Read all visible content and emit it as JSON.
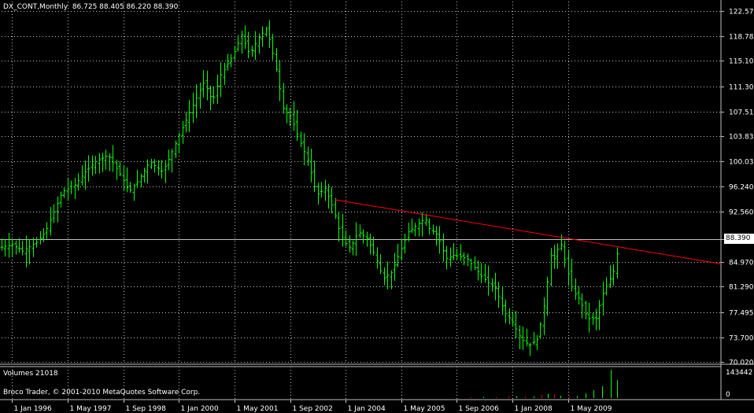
{
  "header": {
    "symbol_text": "DX_CONT,Monthly",
    "ohlc_text": "86.725 88.405 86.220 88.390"
  },
  "volume_header": {
    "label": "Volumes 21018"
  },
  "copyright": "Broco Trader, © 2001-2010 MetaQuotes Software Corp.",
  "current_price_label": "88.390",
  "colors": {
    "background": "#000000",
    "candle": "#00ff00",
    "trendline": "#ff0000",
    "grid": "#c0c0c0",
    "axis_text": "#ffffff",
    "volume_green": "#00ff00",
    "volume_red": "#ff0000",
    "price_line": "#c0c0c0"
  },
  "chart_data": {
    "type": "candlestick",
    "symbol": "DX_CONT",
    "timeframe": "Monthly",
    "y_ticks": [
      "122.575",
      "118.780",
      "115.100",
      "111.305",
      "107.510",
      "103.830",
      "100.035",
      "96.240",
      "92.560",
      "88.390",
      "84.970",
      "81.290",
      "77.495",
      "73.700",
      "70.020"
    ],
    "y_tick_values": [
      122.575,
      118.78,
      115.1,
      111.305,
      107.51,
      103.83,
      100.035,
      96.24,
      92.56,
      88.39,
      84.97,
      81.29,
      77.495,
      73.7,
      70.02
    ],
    "ylim": [
      70.02,
      122.575
    ],
    "x_ticks": [
      "1 Jan 1996",
      "1 May 1997",
      "1 Sep 1998",
      "1 Jan 2000",
      "1 May 2001",
      "1 Sep 2002",
      "1 Jan 2004",
      "1 May 2005",
      "1 Sep 2006",
      "1 Jan 2008",
      "1 May 2009"
    ],
    "x_tick_years": [
      1996.0,
      1997.333,
      1998.667,
      2000.0,
      2001.333,
      2002.667,
      2004.0,
      2005.333,
      2006.667,
      2008.0,
      2009.333
    ],
    "xlim": [
      1995.75,
      2013.0
    ],
    "close_path": [
      [
        1995.75,
        87.2
      ],
      [
        1996.0,
        87.6
      ],
      [
        1996.25,
        86.6
      ],
      [
        1996.6,
        88.0
      ],
      [
        1996.8,
        89.5
      ],
      [
        1997.0,
        92.5
      ],
      [
        1997.2,
        95.5
      ],
      [
        1997.5,
        96.5
      ],
      [
        1997.75,
        98.5
      ],
      [
        1998.0,
        100.0
      ],
      [
        1998.3,
        101.0
      ],
      [
        1998.6,
        98.0
      ],
      [
        1998.8,
        95.5
      ],
      [
        1999.0,
        97.0
      ],
      [
        1999.3,
        100.0
      ],
      [
        1999.6,
        98.5
      ],
      [
        1999.8,
        101.0
      ],
      [
        2000.0,
        104.0
      ],
      [
        2000.3,
        108.0
      ],
      [
        2000.6,
        112.0
      ],
      [
        2000.8,
        109.0
      ],
      [
        2001.0,
        113.0
      ],
      [
        2001.3,
        116.0
      ],
      [
        2001.5,
        119.0
      ],
      [
        2001.7,
        116.0
      ],
      [
        2001.9,
        118.5
      ],
      [
        2002.1,
        120.0
      ],
      [
        2002.3,
        115.0
      ],
      [
        2002.5,
        108.0
      ],
      [
        2002.7,
        106.5
      ],
      [
        2002.9,
        103.0
      ],
      [
        2003.1,
        100.0
      ],
      [
        2003.3,
        95.0
      ],
      [
        2003.5,
        96.0
      ],
      [
        2003.7,
        93.0
      ],
      [
        2003.9,
        88.5
      ],
      [
        2004.1,
        87.0
      ],
      [
        2004.3,
        89.5
      ],
      [
        2004.5,
        88.5
      ],
      [
        2004.7,
        86.0
      ],
      [
        2004.9,
        82.5
      ],
      [
        2005.1,
        83.5
      ],
      [
        2005.3,
        86.5
      ],
      [
        2005.5,
        89.5
      ],
      [
        2005.7,
        90.5
      ],
      [
        2005.9,
        91.5
      ],
      [
        2006.0,
        90.0
      ],
      [
        2006.2,
        89.0
      ],
      [
        2006.4,
        85.5
      ],
      [
        2006.6,
        86.0
      ],
      [
        2006.9,
        85.5
      ],
      [
        2007.1,
        84.0
      ],
      [
        2007.3,
        82.5
      ],
      [
        2007.6,
        81.0
      ],
      [
        2007.8,
        77.5
      ],
      [
        2008.0,
        76.0
      ],
      [
        2008.2,
        73.5
      ],
      [
        2008.4,
        72.5
      ],
      [
        2008.6,
        73.5
      ],
      [
        2008.8,
        80.0
      ],
      [
        2008.9,
        86.0
      ],
      [
        2009.0,
        85.5
      ],
      [
        2009.15,
        88.0
      ],
      [
        2009.3,
        84.0
      ],
      [
        2009.45,
        80.5
      ],
      [
        2009.6,
        79.5
      ],
      [
        2009.8,
        76.5
      ],
      [
        2010.0,
        76.5
      ],
      [
        2010.15,
        80.0
      ],
      [
        2010.3,
        82.0
      ],
      [
        2010.45,
        84.0
      ],
      [
        2010.55,
        88.39
      ]
    ],
    "trendline": {
      "start": [
        2003.75,
        94.3
      ],
      "end": [
        2013.0,
        84.7
      ]
    },
    "current_price": 88.39,
    "volume": {
      "label": "Volumes",
      "last_value": 21018,
      "y_ticks": [
        "143442",
        "0"
      ],
      "ymax": 143442,
      "bars": [
        [
          2007.0,
          4000,
          "red"
        ],
        [
          2007.3,
          6000,
          "green"
        ],
        [
          2007.6,
          5000,
          "red"
        ],
        [
          2007.9,
          8000,
          "red"
        ],
        [
          2008.1,
          10000,
          "green"
        ],
        [
          2008.3,
          7000,
          "red"
        ],
        [
          2008.5,
          9000,
          "green"
        ],
        [
          2008.7,
          15000,
          "red"
        ],
        [
          2008.85,
          22000,
          "green"
        ],
        [
          2009.0,
          18000,
          "red"
        ],
        [
          2009.15,
          12000,
          "green"
        ],
        [
          2009.35,
          8000,
          "red"
        ],
        [
          2009.55,
          10000,
          "green"
        ],
        [
          2009.75,
          25000,
          "green"
        ],
        [
          2009.95,
          40000,
          "green"
        ],
        [
          2010.15,
          60000,
          "green"
        ],
        [
          2010.35,
          143442,
          "green"
        ],
        [
          2010.5,
          90000,
          "green"
        ]
      ]
    }
  }
}
